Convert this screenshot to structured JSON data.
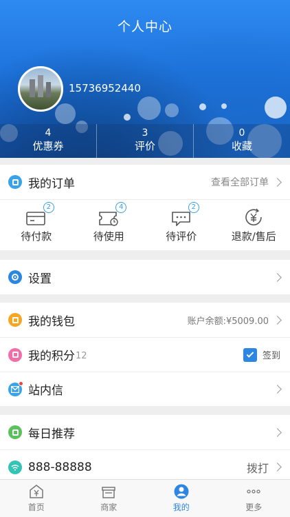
{
  "header": {
    "title": "个人中心",
    "phone": "15736952440",
    "stats": [
      {
        "num": "4",
        "label": "优惠券"
      },
      {
        "num": "3",
        "label": "评价"
      },
      {
        "num": "0",
        "label": "收藏"
      }
    ]
  },
  "orders": {
    "title": "我的订单",
    "view_all": "查看全部订单",
    "items": [
      {
        "label": "待付款",
        "badge": "2",
        "icon": "wallet-card-icon"
      },
      {
        "label": "待使用",
        "badge": "4",
        "icon": "ticket-clock-icon"
      },
      {
        "label": "待评价",
        "badge": "2",
        "icon": "chat-bubble-icon"
      },
      {
        "label": "退款/售后",
        "badge": "",
        "icon": "yen-refund-icon"
      }
    ]
  },
  "settings": {
    "label": "设置",
    "icon": "gear-icon",
    "color": "#2d86e0"
  },
  "wallet": {
    "label": "我的钱包",
    "balance": "账户余额:¥5009.00",
    "color": "#f5a623"
  },
  "points": {
    "label": "我的积分",
    "count": "12",
    "signin": "签到",
    "color": "#f06fa8"
  },
  "messages": {
    "label": "站内信",
    "color": "#3aa3e8"
  },
  "recommend": {
    "label": "每日推荐",
    "color": "#5cc05c"
  },
  "hotline": {
    "number": "888-88888",
    "action": "拨打",
    "color": "#35c4b4"
  },
  "tabs": [
    {
      "label": "首页",
      "icon": "home-yen-icon"
    },
    {
      "label": "商家",
      "icon": "store-icon"
    },
    {
      "label": "我的",
      "icon": "user-icon"
    },
    {
      "label": "更多",
      "icon": "more-dots-icon"
    }
  ],
  "colors": {
    "accent": "#2d86e0",
    "header": "#1e74dd"
  }
}
